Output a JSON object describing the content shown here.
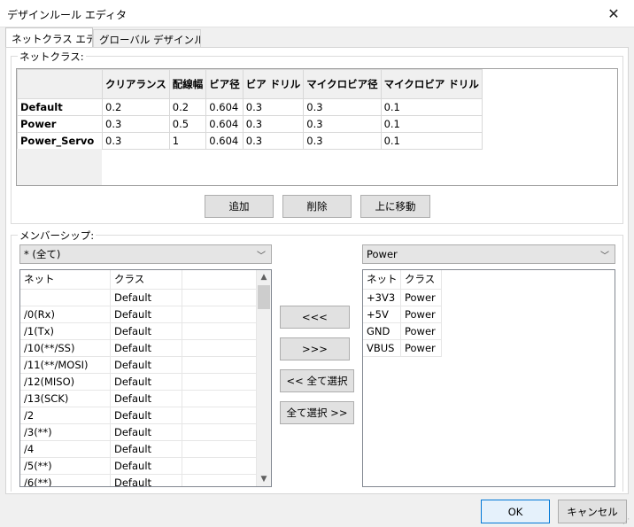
{
  "window": {
    "title": "デザインルール エディタ",
    "close_glyph": "✕"
  },
  "tabs": [
    {
      "label": "ネットクラス エディタ",
      "active": true
    },
    {
      "label": "グローバル デザインルール",
      "active": false
    }
  ],
  "netclasses": {
    "group_label": "ネットクラス:",
    "columns": [
      "クリアランス",
      "配線幅",
      "ビア径",
      "ビア ドリル",
      "マイクロビア径",
      "マイクロビア ドリル"
    ],
    "rows": [
      {
        "name": "Default",
        "values": [
          "0.2",
          "0.2",
          "0.604",
          "0.3",
          "0.3",
          "0.1"
        ]
      },
      {
        "name": "Power",
        "values": [
          "0.3",
          "0.5",
          "0.604",
          "0.3",
          "0.3",
          "0.1"
        ]
      },
      {
        "name": "Power_Servo",
        "values": [
          "0.3",
          "1",
          "0.604",
          "0.3",
          "0.3",
          "0.1"
        ]
      }
    ],
    "buttons": {
      "add": "追加",
      "delete": "削除",
      "move_up": "上に移動"
    }
  },
  "membership": {
    "group_label": "メンバーシップ:",
    "left_filter": "* (全て)",
    "right_filter": "Power",
    "left_list": {
      "headers": [
        "ネット",
        "クラス"
      ],
      "rows": [
        [
          "",
          "Default"
        ],
        [
          "/0(Rx)",
          "Default"
        ],
        [
          "/1(Tx)",
          "Default"
        ],
        [
          "/10(**/SS)",
          "Default"
        ],
        [
          "/11(**/MOSI)",
          "Default"
        ],
        [
          "/12(MISO)",
          "Default"
        ],
        [
          "/13(SCK)",
          "Default"
        ],
        [
          "/2",
          "Default"
        ],
        [
          "/3(**)",
          "Default"
        ],
        [
          "/4",
          "Default"
        ],
        [
          "/5(**)",
          "Default"
        ],
        [
          "/6(**)",
          "Default"
        ]
      ]
    },
    "right_list": {
      "headers": [
        "ネット",
        "クラス"
      ],
      "rows": [
        [
          "+3V3",
          "Power"
        ],
        [
          "+5V",
          "Power"
        ],
        [
          "GND",
          "Power"
        ],
        [
          "VBUS",
          "Power"
        ]
      ]
    },
    "buttons": {
      "move_left": "<<<",
      "move_right": ">>>",
      "select_all_left": "<< 全て選択",
      "select_all_right": "全て選択 >>"
    }
  },
  "footer": {
    "ok": "OK",
    "cancel": "キャンセル"
  }
}
